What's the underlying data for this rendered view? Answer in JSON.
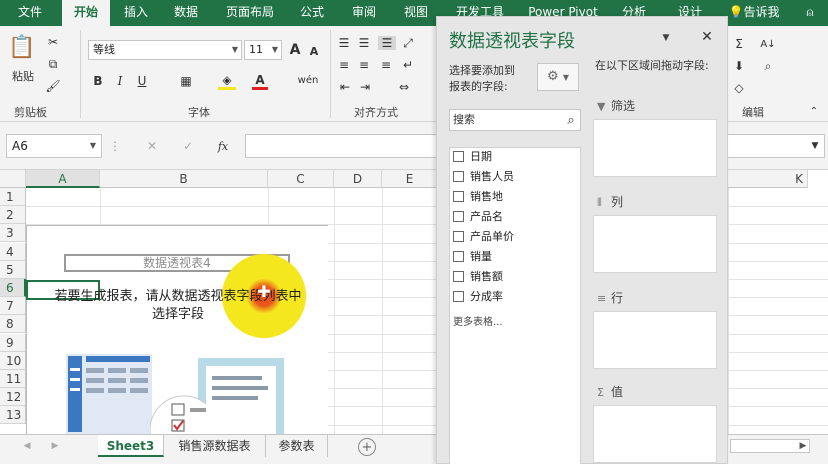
{
  "tabs": [
    "文件",
    "开始",
    "插入",
    "数据",
    "页面布局",
    "公式",
    "审阅",
    "视图",
    "开发工具",
    "Power Pivot",
    "分析",
    "设计",
    "告诉我"
  ],
  "active_tab": "开始",
  "ribbon": {
    "clipboard": {
      "paste": "粘贴",
      "label": "剪贴板"
    },
    "font": {
      "name": "等线",
      "size": "11",
      "bold": "B",
      "italic": "I",
      "underline": "U",
      "grow": "A",
      "shrink": "A",
      "wen": "wén",
      "label": "字体"
    },
    "align": {
      "label": "对齐方式"
    },
    "edit": {
      "label": "编辑"
    }
  },
  "formula_bar": {
    "name_box": "A6",
    "cancel": "✕",
    "enter": "✓",
    "fx": "fx",
    "value": ""
  },
  "grid": {
    "columns": [
      "A",
      "B",
      "C",
      "D",
      "E",
      "K"
    ],
    "rows": [
      "1",
      "2",
      "3",
      "4",
      "5",
      "6",
      "7",
      "8",
      "9",
      "10",
      "11",
      "12",
      "13"
    ],
    "pivot_title": "数据透视表4",
    "pivot_hint_line1": "若要生成报表，请从数据透视表字段列表中",
    "pivot_hint_line2": "选择字段"
  },
  "sheets": [
    "Sheet3",
    "销售源数据表",
    "参数表"
  ],
  "active_sheet": "Sheet3",
  "pane": {
    "title": "数据透视表字段",
    "choose_label_1": "选择要添加到",
    "choose_label_2": "报表的字段:",
    "drag_label": "在以下区域间拖动字段:",
    "search_placeholder": "搜索",
    "fields": [
      "日期",
      "销售人员",
      "销售地",
      "产品名",
      "产品单价",
      "销量",
      "销售额",
      "分成率"
    ],
    "more_tables": "更多表格...",
    "areas": [
      {
        "label": "筛选",
        "icon": "filter-icon"
      },
      {
        "label": "列",
        "icon": "columns-icon"
      },
      {
        "label": "行",
        "icon": "rows-icon"
      },
      {
        "label": "值",
        "icon": "sigma-icon"
      }
    ]
  },
  "colors": {
    "brand": "#217346",
    "highlight": "#f5e71e",
    "cursor_ring": "#e8541a"
  }
}
